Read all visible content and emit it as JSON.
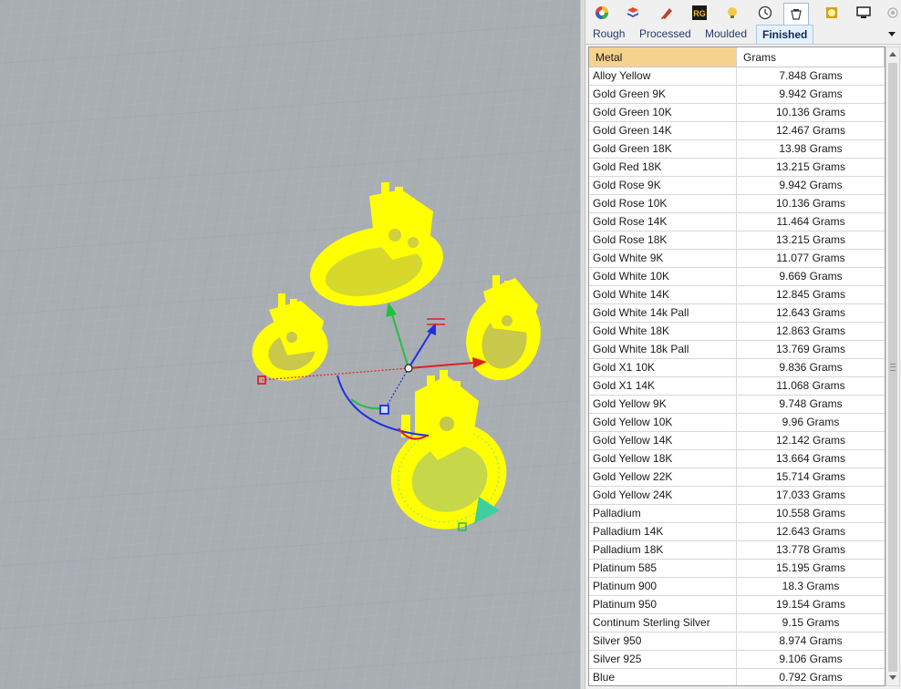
{
  "panel": {
    "toolbar_icons": [
      "color-wheel-icon",
      "layers-icon",
      "pen-icon",
      "rg-plugin-icon",
      "light-bulb-icon",
      "history-icon",
      "ring-weight-icon",
      "gems-icon",
      "display-icon",
      "settings-icon"
    ],
    "tabs": [
      {
        "label": "Rough"
      },
      {
        "label": "Processed"
      },
      {
        "label": "Moulded"
      },
      {
        "label": "Finished"
      }
    ],
    "active_tab": "Finished"
  },
  "table": {
    "headers": {
      "metal": "Metal",
      "grams": "Grams"
    },
    "rows": [
      {
        "metal": "Alloy Yellow",
        "grams": "7.848 Grams"
      },
      {
        "metal": "Gold Green 9K",
        "grams": "9.942 Grams"
      },
      {
        "metal": "Gold Green 10K",
        "grams": "10.136 Grams"
      },
      {
        "metal": "Gold Green 14K",
        "grams": "12.467 Grams"
      },
      {
        "metal": "Gold Green 18K",
        "grams": "13.98 Grams"
      },
      {
        "metal": "Gold Red 18K",
        "grams": "13.215 Grams"
      },
      {
        "metal": "Gold Rose 9K",
        "grams": "9.942 Grams"
      },
      {
        "metal": "Gold Rose 10K",
        "grams": "10.136 Grams"
      },
      {
        "metal": "Gold Rose 14K",
        "grams": "11.464 Grams"
      },
      {
        "metal": "Gold Rose 18K",
        "grams": "13.215 Grams"
      },
      {
        "metal": "Gold White 9K",
        "grams": "11.077 Grams"
      },
      {
        "metal": "Gold White 10K",
        "grams": "9.669 Grams"
      },
      {
        "metal": "Gold White 14K",
        "grams": "12.845 Grams"
      },
      {
        "metal": "Gold White 14k Pall",
        "grams": "12.643 Grams"
      },
      {
        "metal": "Gold White 18K",
        "grams": "12.863 Grams"
      },
      {
        "metal": "Gold White 18k Pall",
        "grams": "13.769 Grams"
      },
      {
        "metal": "Gold X1 10K",
        "grams": "9.836 Grams"
      },
      {
        "metal": "Gold X1 14K",
        "grams": "11.068 Grams"
      },
      {
        "metal": "Gold Yellow 9K",
        "grams": "9.748 Grams"
      },
      {
        "metal": "Gold Yellow 10K",
        "grams": "9.96 Grams"
      },
      {
        "metal": "Gold Yellow 14K",
        "grams": "12.142 Grams"
      },
      {
        "metal": "Gold Yellow 18K",
        "grams": "13.664 Grams"
      },
      {
        "metal": "Gold Yellow 22K",
        "grams": "15.714 Grams"
      },
      {
        "metal": "Gold Yellow 24K",
        "grams": "17.033 Grams"
      },
      {
        "metal": "Palladium",
        "grams": "10.558 Grams"
      },
      {
        "metal": "Palladium 14K",
        "grams": "12.643 Grams"
      },
      {
        "metal": "Palladium 18K",
        "grams": "13.778 Grams"
      },
      {
        "metal": "Platinum 585",
        "grams": "15.195 Grams"
      },
      {
        "metal": "Platinum 900",
        "grams": "18.3 Grams"
      },
      {
        "metal": "Platinum 950",
        "grams": "19.154 Grams"
      },
      {
        "metal": "Continum Sterling Silver",
        "grams": "9.15 Grams"
      },
      {
        "metal": "Silver 950",
        "grams": "8.974 Grams"
      },
      {
        "metal": "Silver 925",
        "grams": "9.106 Grams"
      },
      {
        "metal": "Blue",
        "grams": "0.792 Grams"
      }
    ]
  },
  "colors": {
    "viewport_bg": "#a9aeb3",
    "selection_yellow": "#ffff00",
    "header_highlight": "#f6d28f",
    "x_axis": "#e02020",
    "y_axis": "#20c040",
    "z_axis": "#2030e0"
  }
}
